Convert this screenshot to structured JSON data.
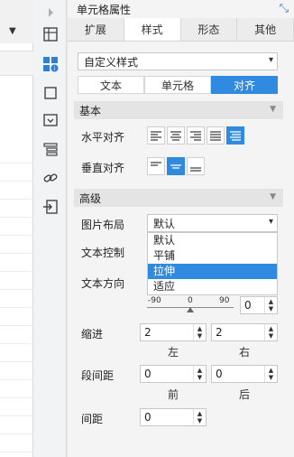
{
  "panel": {
    "title": "单元格属性",
    "tabs": [
      "扩展",
      "样式",
      "形态",
      "其他"
    ],
    "active_tab": "样式",
    "style_select": "自定义样式",
    "subtabs": [
      "文本",
      "单元格",
      "对齐"
    ],
    "active_subtab": "对齐"
  },
  "basic": {
    "title": "基本",
    "h_align_label": "水平对齐",
    "v_align_label": "垂直对齐"
  },
  "advanced": {
    "title": "高级",
    "image_layout_label": "图片布局",
    "image_layout_value": "默认",
    "image_layout_options": [
      "默认",
      "平铺",
      "拉伸",
      "适应"
    ],
    "image_layout_highlighted": "拉伸",
    "text_control_label": "文本控制",
    "text_direction_label": "文本方向",
    "rotation_ticks": [
      "-90",
      "0",
      "90"
    ],
    "rotation_value": "0",
    "indent_label": "缩进",
    "indent_left": "2",
    "indent_right": "2",
    "left_label": "左",
    "right_label": "右",
    "para_spacing_label": "段间距",
    "para_before": "0",
    "para_after": "0",
    "before_label": "前",
    "after_label": "后",
    "spacing_label": "间距",
    "spacing_value": "0"
  },
  "colors": {
    "accent": "#2f8ae0"
  }
}
